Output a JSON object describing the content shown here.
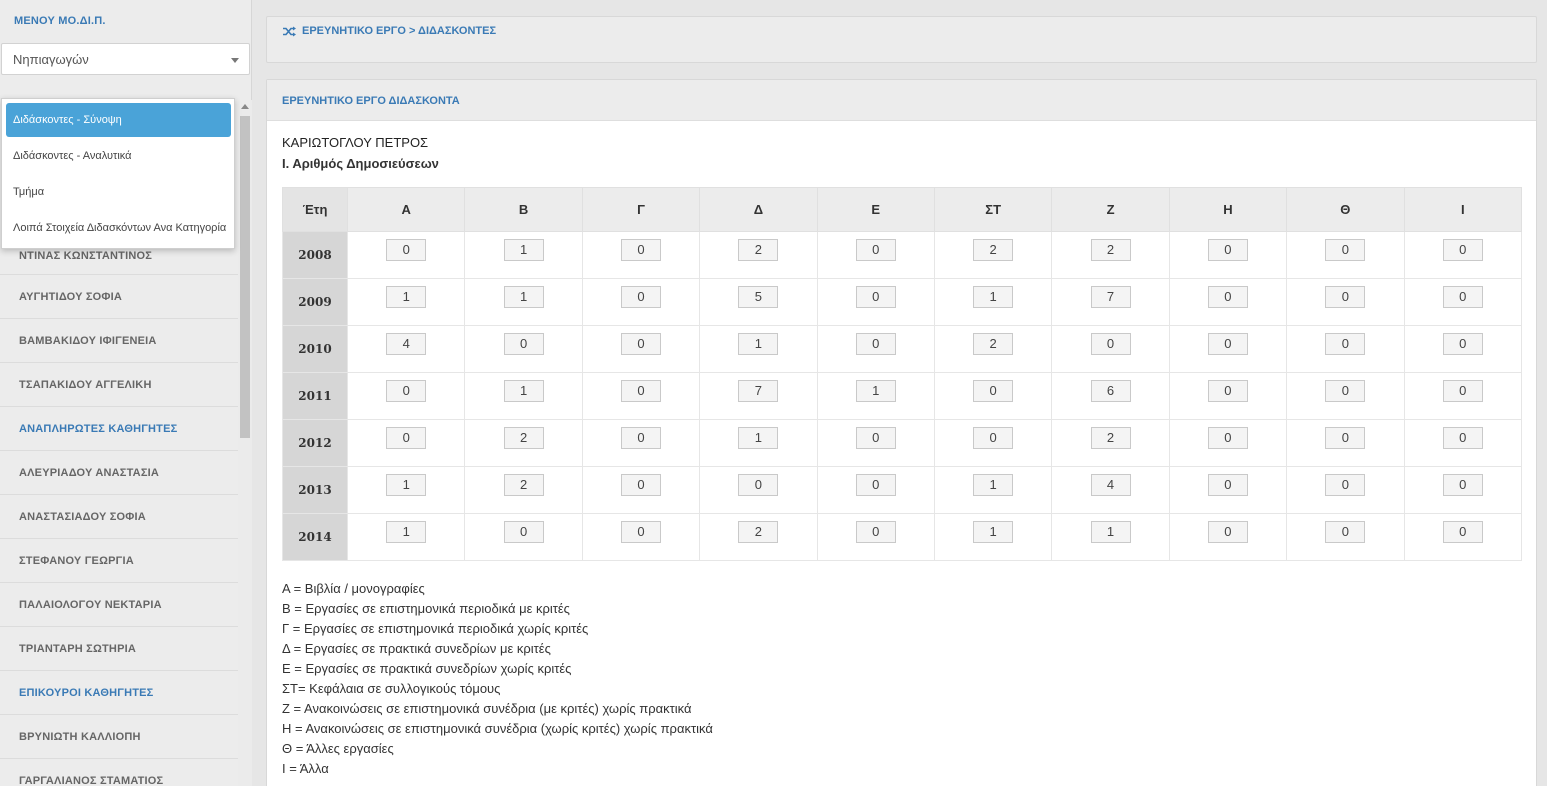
{
  "sidebar": {
    "title": "ΜΕΝΟΥ ΜΟ.ΔΙ.Π.",
    "department_select": "Νηπιαγωγών",
    "items": [
      {
        "label": "ΝΤΙΝΑΣ ΚΩΝΣΤΑΝΤΙΝΟΣ",
        "type": "person"
      },
      {
        "label": "ΑΥΓΗΤΙΔΟΥ ΣΟΦΙΑ",
        "type": "person"
      },
      {
        "label": "ΒΑΜΒΑΚΙΔΟΥ ΙΦΙΓΕΝΕΙΑ",
        "type": "person"
      },
      {
        "label": "ΤΣΑΠΑΚΙΔΟΥ ΑΓΓΕΛΙΚΗ",
        "type": "person"
      },
      {
        "label": "ΑΝΑΠΛΗΡΩΤΕΣ ΚΑΘΗΓΗΤΕΣ",
        "type": "section"
      },
      {
        "label": "ΑΛΕΥΡΙΑΔΟΥ ΑΝΑΣΤΑΣΙΑ",
        "type": "person"
      },
      {
        "label": "ΑΝΑΣΤΑΣΙΑΔΟΥ ΣΟΦΙΑ",
        "type": "person"
      },
      {
        "label": "ΣΤΕΦΑΝΟΥ ΓΕΩΡΓΙΑ",
        "type": "person"
      },
      {
        "label": "ΠΑΛΑΙΟΛΟΓΟΥ ΝΕΚΤΑΡΙΑ",
        "type": "person"
      },
      {
        "label": "ΤΡΙΑΝΤΑΡΗ ΣΩΤΗΡΙΑ",
        "type": "person"
      },
      {
        "label": "ΕΠΙΚΟΥΡΟΙ ΚΑΘΗΓΗΤΕΣ",
        "type": "section"
      },
      {
        "label": "ΒΡΥΝΙΩΤΗ ΚΑΛΛΙΟΠΗ",
        "type": "person"
      },
      {
        "label": "ΓΑΡΓΑΛΙΑΝΟΣ ΣΤΑΜΑΤΙΟΣ",
        "type": "person"
      }
    ]
  },
  "dropdown": {
    "items": [
      {
        "label": "Διδάσκοντες - Σύνοψη",
        "selected": true
      },
      {
        "label": "Διδάσκοντες - Αναλυτικά",
        "selected": false
      },
      {
        "label": "Τμήμα",
        "selected": false
      },
      {
        "label": "Λοιπά Στοιχεία Διδασκόντων Ανα Κατηγορία",
        "selected": false
      }
    ]
  },
  "breadcrumb": {
    "icon": "shuffle-icon",
    "text": "ΕΡΕΥΝΗΤΙΚΟ ΕΡΓΟ > ΔΙΔΑΣΚΟΝΤΕΣ"
  },
  "main": {
    "title": "ΕΡΕΥΝΗΤΙΚΟ ΕΡΓΟ ΔΙΔΑΣΚΟΝΤΑ",
    "person": "ΚΑΡΙΩΤΟΓΛΟΥ ΠΕΤΡΟΣ",
    "subtitle": "Ι. Αριθμός Δημοσιεύσεων",
    "table": {
      "year_header": "Έτη",
      "columns": [
        "Α",
        "Β",
        "Γ",
        "Δ",
        "Ε",
        "ΣΤ",
        "Ζ",
        "Η",
        "Θ",
        "Ι"
      ],
      "rows": [
        {
          "year": "2008",
          "values": [
            "0",
            "1",
            "0",
            "2",
            "0",
            "2",
            "2",
            "0",
            "0",
            "0"
          ]
        },
        {
          "year": "2009",
          "values": [
            "1",
            "1",
            "0",
            "5",
            "0",
            "1",
            "7",
            "0",
            "0",
            "0"
          ]
        },
        {
          "year": "2010",
          "values": [
            "4",
            "0",
            "0",
            "1",
            "0",
            "2",
            "0",
            "0",
            "0",
            "0"
          ]
        },
        {
          "year": "2011",
          "values": [
            "0",
            "1",
            "0",
            "7",
            "1",
            "0",
            "6",
            "0",
            "0",
            "0"
          ]
        },
        {
          "year": "2012",
          "values": [
            "0",
            "2",
            "0",
            "1",
            "0",
            "0",
            "2",
            "0",
            "0",
            "0"
          ]
        },
        {
          "year": "2013",
          "values": [
            "1",
            "2",
            "0",
            "0",
            "0",
            "1",
            "4",
            "0",
            "0",
            "0"
          ]
        },
        {
          "year": "2014",
          "values": [
            "1",
            "0",
            "0",
            "2",
            "0",
            "1",
            "1",
            "0",
            "0",
            "0"
          ]
        }
      ]
    },
    "legend": [
      "Α = Βιβλία / μονογραφίες",
      "Β = Εργασίες σε επιστημονικά περιοδικά με κριτές",
      "Γ = Εργασίες σε επιστημονικά περιοδικά χωρίς κριτές",
      "Δ = Εργασίες σε πρακτικά συνεδρίων με κριτές",
      "Ε = Εργασίες σε πρακτικά συνεδρίων χωρίς κριτές",
      "ΣΤ= Κεφάλαια σε συλλογικούς τόμους",
      "Ζ = Ανακοινώσεις σε επιστημονικά συνέδρια (με κριτές) χωρίς πρακτικά",
      "Η = Ανακοινώσεις σε επιστημονικά συνέδρια (χωρίς κριτές) χωρίς πρακτικά",
      "Θ = Άλλες εργασίες",
      "Ι = Άλλα"
    ]
  },
  "colors": {
    "accent": "#3a7ab5",
    "selected": "#4aa3d8"
  }
}
